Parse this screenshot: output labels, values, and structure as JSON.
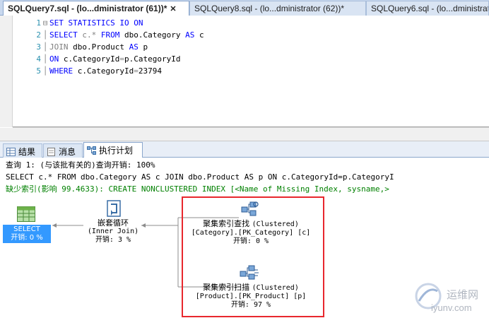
{
  "doc_tabs": [
    {
      "label": "SQLQuery7.sql - (lo...dministrator (61))*",
      "active": true
    },
    {
      "label": "SQLQuery8.sql - (lo...dministrator (62))*",
      "active": false
    },
    {
      "label": "SQLQuery6.sql - (lo...dministrator",
      "active": false
    }
  ],
  "editor": {
    "lines": [
      {
        "num": "1",
        "parts": [
          {
            "t": "SET STATISTICS IO ON",
            "c": "kw"
          }
        ]
      },
      {
        "num": "2",
        "parts": [
          {
            "t": "SELECT ",
            "c": "kw"
          },
          {
            "t": "c.* ",
            "c": "gray"
          },
          {
            "t": "FROM ",
            "c": "kw"
          },
          {
            "t": "dbo.Category ",
            "c": "plain"
          },
          {
            "t": "AS ",
            "c": "kw"
          },
          {
            "t": "c",
            "c": "plain"
          }
        ]
      },
      {
        "num": "3",
        "parts": [
          {
            "t": "JOIN ",
            "c": "gray"
          },
          {
            "t": "dbo.Product ",
            "c": "plain"
          },
          {
            "t": "AS ",
            "c": "kw"
          },
          {
            "t": "p",
            "c": "plain"
          }
        ]
      },
      {
        "num": "4",
        "parts": [
          {
            "t": "ON ",
            "c": "kw"
          },
          {
            "t": "c.CategoryId",
            "c": "plain"
          },
          {
            "t": "=",
            "c": "gray"
          },
          {
            "t": "p.CategoryId",
            "c": "plain"
          }
        ]
      },
      {
        "num": "5",
        "parts": [
          {
            "t": "WHERE ",
            "c": "kw"
          },
          {
            "t": "c.CategoryId",
            "c": "plain"
          },
          {
            "t": "=",
            "c": "gray"
          },
          {
            "t": "23794",
            "c": "plain"
          }
        ]
      }
    ]
  },
  "result_tabs": [
    {
      "label": "结果",
      "icon": "grid-icon",
      "active": false
    },
    {
      "label": "消息",
      "icon": "message-icon",
      "active": false
    },
    {
      "label": "执行计划",
      "icon": "plan-icon",
      "active": true
    }
  ],
  "plan": {
    "query_header": "查询 1: (与该批有关的)查询开销: 100%",
    "query_text": "SELECT c.* FROM dbo.Category AS c JOIN dbo.Product AS p ON c.CategoryId=p.CategoryI",
    "missing_index": "缺少索引(影响 99.4633): CREATE NONCLUSTERED INDEX [<Name of Missing Index, sysname,>",
    "nodes": {
      "select": {
        "label": "SELECT",
        "cost": "开销: 0 %"
      },
      "nested_loops": {
        "title": "嵌套循环",
        "subtitle": "(Inner Join)",
        "cost": "开销: 3 %"
      },
      "seek": {
        "title": "聚集索引查找",
        "kind": "(Clustered)",
        "object": "[Category].[PK_Category] [c]",
        "cost": "开销: 0 %"
      },
      "scan": {
        "title": "聚集索引扫描",
        "kind": "(Clustered)",
        "object": "[Product].[PK_Product] [p]",
        "cost": "开销: 97 %"
      }
    }
  },
  "watermark": {
    "cn": "运维网",
    "url": "iyunv.com"
  },
  "colors": {
    "selected_node": "#3399ff",
    "highlight_border": "#e8272d",
    "keyword": "#0000ff",
    "missing_index": "#008000"
  }
}
